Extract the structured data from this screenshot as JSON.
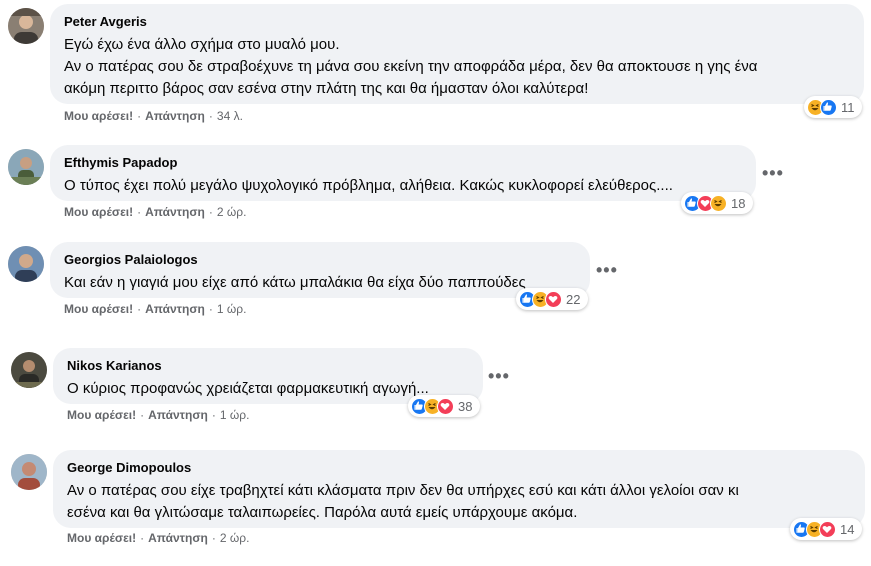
{
  "actions": {
    "like_label": "Μου αρέσει!",
    "reply_label": "Απάντηση",
    "separator": "·"
  },
  "more_glyph": "•••",
  "colors": {
    "like": "#1877f2",
    "haha": "#f7b125",
    "love": "#f33e58",
    "bubble": "#f0f2f5",
    "meta_text": "#65676b"
  },
  "comments": [
    {
      "author": "Peter Avgeris",
      "lines": [
        "Εγώ έχω ένα άλλο σχήμα στο μυαλό μου.",
        "Αν ο πατέρας σου δε στραβοέχυνε τη μάνα σου εκείνη την αποφράδα μέρα, δεν θα αποκτουσε η γης ένα",
        "ακόμη περιττο βάρος σαν εσένα στην πλάτη της και θα ήμασταν όλοι καλύτερα!"
      ],
      "reactions": [
        "haha",
        "like"
      ],
      "reaction_count": "11",
      "time": "34 λ."
    },
    {
      "author": "Efthymis Papadop",
      "lines": [
        "Ο τύπος έχει πολύ μεγάλο ψυχολογικό πρόβλημα, αλήθεια. Κακώς κυκλοφορεί ελεύθερος...."
      ],
      "reactions": [
        "like",
        "love",
        "haha"
      ],
      "reaction_count": "18",
      "time": "2 ώρ."
    },
    {
      "author": "Georgios Palaiologos",
      "lines": [
        "Και εάν η γιαγιά μου είχε από κάτω μπαλάκια θα είχα δύο παππούδες"
      ],
      "reactions": [
        "like",
        "haha",
        "love"
      ],
      "reaction_count": "22",
      "time": "1 ώρ."
    },
    {
      "author": "Nikos Karianos",
      "lines": [
        "Ο κύριος προφανώς χρειάζεται φαρμακευτική αγωγή..."
      ],
      "reactions": [
        "like",
        "haha",
        "love"
      ],
      "reaction_count": "38",
      "time": "1 ώρ."
    },
    {
      "author": "George Dimopoulos",
      "lines": [
        "Αν ο πατέρας σου είχε τραβηχτεί κάτι κλάσματα πριν δεν θα υπήρχες εσύ και κάτι άλλοι γελοίοι σαν κι",
        "εσένα και θα γλιτώσαμε ταλαιπωρείες. Παρόλα αυτά εμείς υπάρχουμε ακόμα."
      ],
      "reactions": [
        "like",
        "haha",
        "love"
      ],
      "reaction_count": "14",
      "time": "2 ώρ."
    }
  ]
}
